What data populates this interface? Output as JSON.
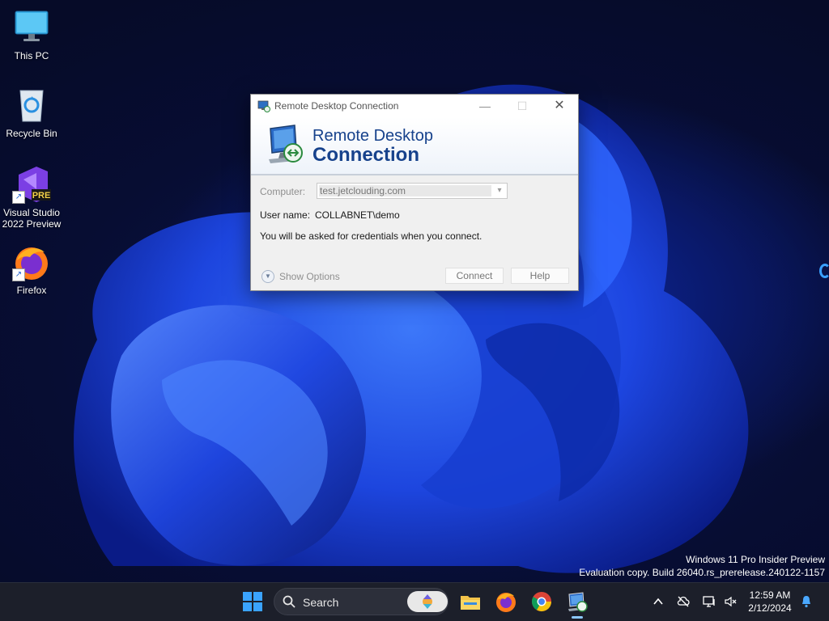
{
  "desktop": {
    "icons": [
      {
        "label": "This PC",
        "icon": "monitor-icon"
      },
      {
        "label": "Recycle Bin",
        "icon": "recycle-bin-icon"
      },
      {
        "label": "Visual Studio 2022 Preview",
        "icon": "visual-studio-icon",
        "badge": "PRE"
      },
      {
        "label": "Firefox",
        "icon": "firefox-icon"
      }
    ],
    "watermark": {
      "line1": "Windows 11 Pro Insider Preview",
      "line2": "Evaluation copy. Build 26040.rs_prerelease.240122-1157"
    }
  },
  "dialog": {
    "title": "Remote Desktop Connection",
    "controls": {
      "minimize": "—",
      "maximize": "☐",
      "close": "✕"
    },
    "banner": {
      "line1": "Remote Desktop",
      "line2": "Connection"
    },
    "computer_label": "Computer:",
    "computer_value": "test.jetclouding.com",
    "username_label": "User name:",
    "username_value": "COLLABNET\\demo",
    "info": "You will be asked for credentials when you connect.",
    "show_options": "Show Options",
    "connect": "Connect",
    "help": "Help"
  },
  "taskbar": {
    "search_label": "Search",
    "apps": [
      "file-explorer-icon",
      "firefox-icon",
      "chrome-icon",
      "remote-desktop-icon"
    ],
    "tray": [
      "chevron-up-icon",
      "cloud-offline-icon",
      "network-icon",
      "volume-muted-icon",
      "notification-bell-icon"
    ],
    "time": "12:59 AM",
    "date": "2/12/2024"
  },
  "colors": {
    "dialog_heading": "#17428c",
    "taskbar": "#1c1f2a",
    "wallpaper_blue": "#1f4ff0"
  }
}
